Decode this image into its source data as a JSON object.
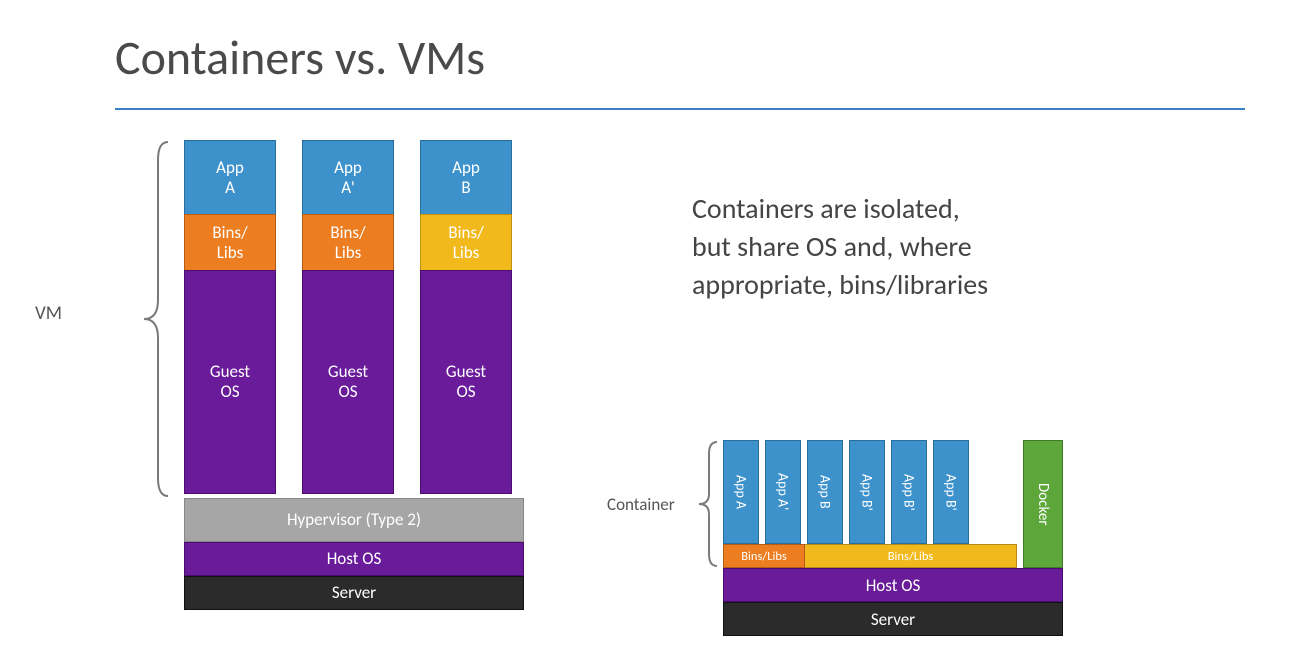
{
  "title": "Containers vs. VMs",
  "vm": {
    "label": "VM",
    "cols": [
      {
        "app": "App\nA",
        "bins": "Bins/\nLibs",
        "bins_color": "orange",
        "guest": "Guest\nOS"
      },
      {
        "app": "App\nA'",
        "bins": "Bins/\nLibs",
        "bins_color": "orange",
        "guest": "Guest\nOS"
      },
      {
        "app": "App\nB",
        "bins": "Bins/\nLibs",
        "bins_color": "yellow",
        "guest": "Guest\nOS"
      }
    ],
    "base": {
      "hypervisor": "Hypervisor (Type 2)",
      "host_os": "Host OS",
      "server": "Server"
    }
  },
  "explanation": "Containers are isolated,\nbut share OS and, where\nappropriate, bins/libraries",
  "container": {
    "label": "Container",
    "apps": [
      "App A",
      "App A'",
      "App B",
      "App B'",
      "App B'",
      "App B'"
    ],
    "docker": "Docker",
    "bins_left": "Bins/Libs",
    "bins_right": "Bins/Libs",
    "host_os": "Host OS",
    "server": "Server"
  },
  "colors": {
    "app": "#3e92cc",
    "bins_orange": "#ec7d21",
    "bins_yellow": "#f2b91c",
    "guest_host": "#6a1b9a",
    "hypervisor": "#a6a6a6",
    "server": "#2b2b2b",
    "docker": "#5da639",
    "rule": "#3b7fc4"
  }
}
